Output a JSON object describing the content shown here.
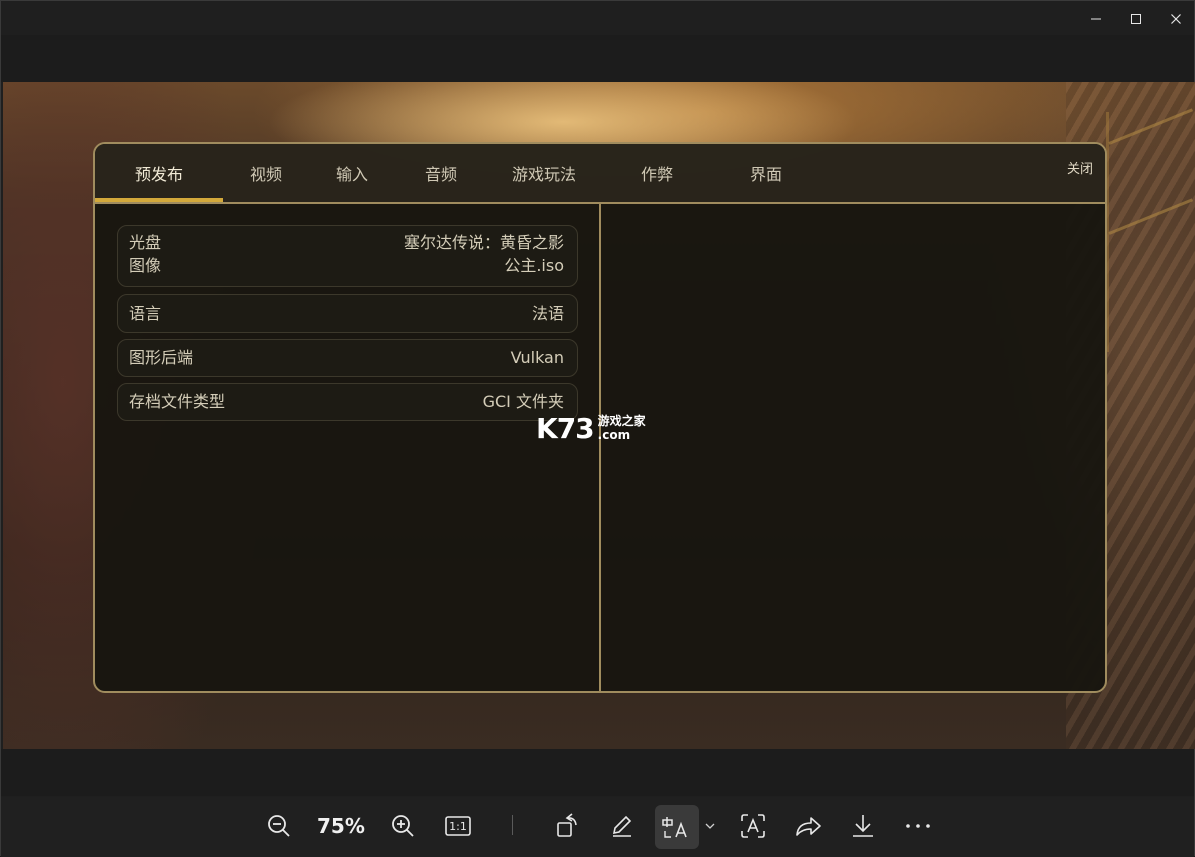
{
  "window": {
    "controls": [
      "minimize-icon",
      "maximize-icon",
      "close-icon"
    ]
  },
  "dialog": {
    "tabs": [
      {
        "label": "预发布",
        "active": true
      },
      {
        "label": "视频"
      },
      {
        "label": "输入"
      },
      {
        "label": "音频"
      },
      {
        "label": "游戏玩法"
      },
      {
        "label": "作弊"
      },
      {
        "label": "界面"
      }
    ],
    "close_label": "关闭",
    "settings": [
      {
        "key_line1": "光盘",
        "key_line2": "图像",
        "value_line1": "塞尔达传说：黄昏之影",
        "value_line2": "公主.iso"
      },
      {
        "key": "语言",
        "value": "法语"
      },
      {
        "key": "图形后端",
        "value": "Vulkan"
      },
      {
        "key": "存档文件类型",
        "value": "GCI 文件夹"
      }
    ]
  },
  "watermark": {
    "logo": "K73",
    "text_top": "游戏之家",
    "text_bottom": ".com"
  },
  "toolbar": {
    "zoom_value": "75%",
    "actual_size_label": "1:1",
    "accent": "#d3a93b"
  }
}
